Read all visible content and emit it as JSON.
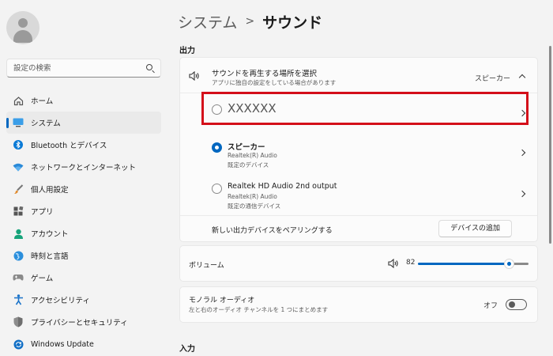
{
  "sidebar": {
    "search_placeholder": "設定の検索",
    "items": [
      {
        "label": "ホーム",
        "icon": "home-icon"
      },
      {
        "label": "システム",
        "icon": "monitor-icon"
      },
      {
        "label": "Bluetooth とデバイス",
        "icon": "bluetooth-icon"
      },
      {
        "label": "ネットワークとインターネット",
        "icon": "wifi-icon"
      },
      {
        "label": "個人用設定",
        "icon": "brush-icon"
      },
      {
        "label": "アプリ",
        "icon": "apps-icon"
      },
      {
        "label": "アカウント",
        "icon": "person-icon"
      },
      {
        "label": "時刻と言語",
        "icon": "globe-icon"
      },
      {
        "label": "ゲーム",
        "icon": "gamepad-icon"
      },
      {
        "label": "アクセシビリティ",
        "icon": "accessibility-icon"
      },
      {
        "label": "プライバシーとセキュリティ",
        "icon": "shield-icon"
      },
      {
        "label": "Windows Update",
        "icon": "update-icon"
      }
    ],
    "active_index": 1
  },
  "breadcrumb": {
    "parent": "システム",
    "separator": ">",
    "current": "サウンド"
  },
  "output": {
    "section_title": "出力",
    "choose": {
      "title": "サウンドを再生する場所を選択",
      "subtitle": "アプリに独自の設定をしている場合があります",
      "selected": "スピーカー"
    },
    "devices": [
      {
        "name": "XXXXXX",
        "line1": "",
        "line2": "",
        "selected": false
      },
      {
        "name": "スピーカー",
        "line1": "Realtek(R) Audio",
        "line2": "既定のデバイス",
        "selected": true
      },
      {
        "name": "Realtek HD Audio 2nd output",
        "line1": "Realtek(R) Audio",
        "line2": "既定の通信デバイス",
        "selected": false
      }
    ],
    "pair": {
      "label": "新しい出力デバイスをペアリングする",
      "button": "デバイスの追加"
    }
  },
  "volume": {
    "label": "ボリューム",
    "value": "82",
    "level": 0.82
  },
  "mono": {
    "title": "モノラル オーディオ",
    "subtitle": "左と右のオーディオ チャンネルを 1 つにまとめます",
    "state": "オフ"
  },
  "input": {
    "section_title": "入力"
  },
  "colors": {
    "accent": "#0067c0",
    "highlight_box": "#d40f1a"
  }
}
